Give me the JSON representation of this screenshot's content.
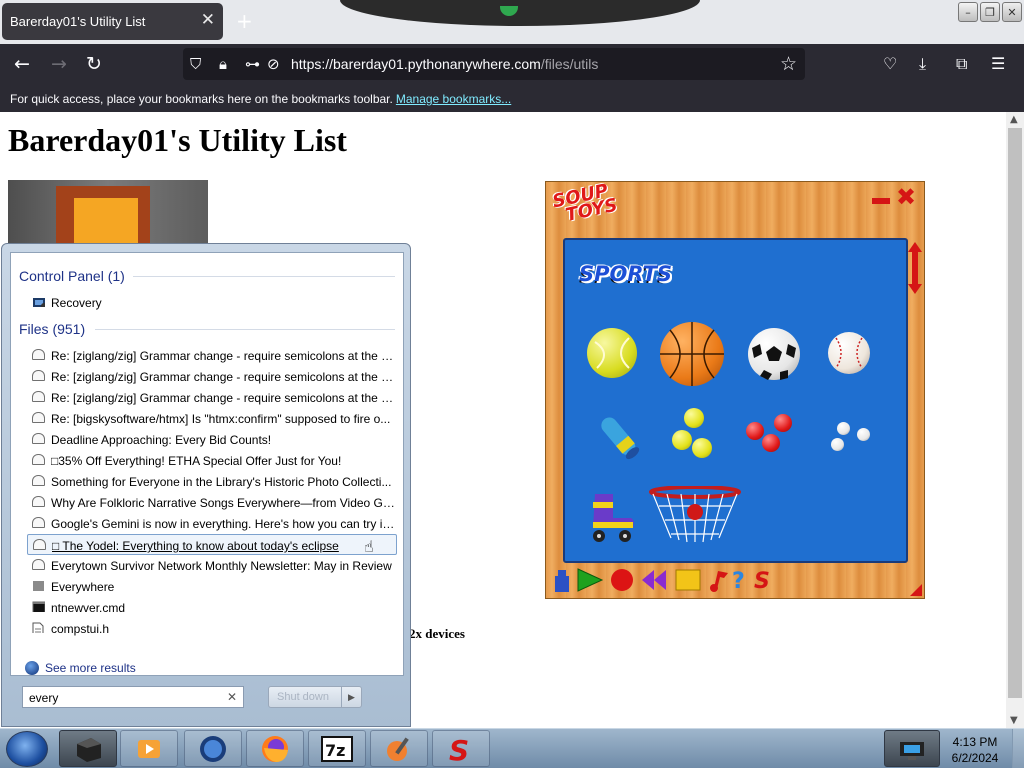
{
  "browser": {
    "tab_title": "Barerday01's Utility List",
    "new_tab": "+",
    "url_host": "https://barerday01.pythonanywhere.com",
    "url_path": "/files/utils",
    "bookmarks_text": "For quick access, place your bookmarks here on the bookmarks toolbar.",
    "bookmarks_link": "Manage bookmarks..."
  },
  "page": {
    "heading": "Barerday01's Utility List",
    "fragment_text": "2x devices"
  },
  "game": {
    "logo_line1": "SOUP",
    "logo_line2": "TOYS",
    "section_title": "SPORTS",
    "colors": {
      "frame": "#e89d50",
      "field": "#1f6fd0",
      "accent": "#d51515"
    }
  },
  "start_menu": {
    "control_panel_header": "Control Panel (1)",
    "control_panel_items": [
      {
        "label": "Recovery",
        "icon": "recovery-icon"
      }
    ],
    "files_header": "Files (951)",
    "files": [
      {
        "label": "Re: [ziglang/zig] Grammar change - require semicolons at the e...",
        "icon": "mail-icon"
      },
      {
        "label": "Re: [ziglang/zig] Grammar change - require semicolons at the e...",
        "icon": "mail-icon"
      },
      {
        "label": "Re: [ziglang/zig] Grammar change - require semicolons at the e...",
        "icon": "mail-icon"
      },
      {
        "label": "Re: [bigskysoftware/htmx] Is \"htmx:confirm\" supposed to fire o...",
        "icon": "mail-icon"
      },
      {
        "label": "Deadline Approaching: Every Bid Counts!",
        "icon": "mail-icon"
      },
      {
        "label": "□35% Off Everything! ETHA Special Offer Just for You!",
        "icon": "mail-icon"
      },
      {
        "label": "Something for Everyone in the Library's Historic Photo Collecti...",
        "icon": "mail-icon"
      },
      {
        "label": "Why Are Folkloric Narrative Songs Everywhere—from Video Ga...",
        "icon": "mail-icon"
      },
      {
        "label": "Google's Gemini is now in everything. Here's how you can try it....",
        "icon": "mail-icon"
      },
      {
        "label": "□ The Yodel: Everything to know about today's eclipse",
        "icon": "mail-icon"
      },
      {
        "label": "Everytown Survivor Network Monthly Newsletter: May in Review",
        "icon": "mail-icon"
      },
      {
        "label": "Everywhere",
        "icon": "file-icon"
      },
      {
        "label": "ntnewver.cmd",
        "icon": "cmd-icon"
      },
      {
        "label": "compstui.h",
        "icon": "text-file-icon"
      }
    ],
    "highlighted_index": 9,
    "see_more": "See more results",
    "search_value": "every",
    "shutdown_label": "Shut down"
  },
  "taskbar": {
    "time": "4:13 PM",
    "date": "6/2/2024"
  }
}
